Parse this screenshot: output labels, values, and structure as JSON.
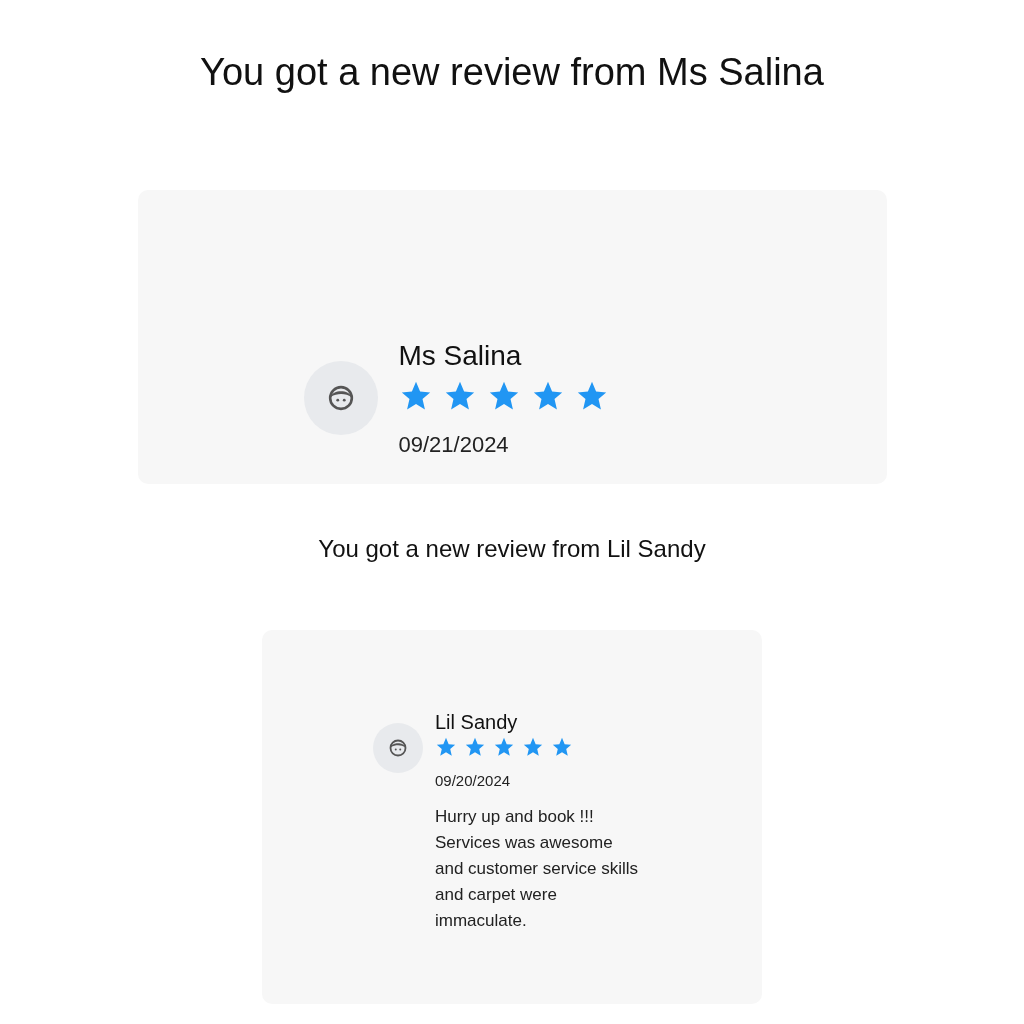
{
  "reviews": [
    {
      "heading": "You got a new review from Ms Salina",
      "name": "Ms Salina",
      "stars": 5,
      "date": "09/21/2024"
    },
    {
      "heading": "You got a new review from Lil Sandy",
      "name": "Lil Sandy",
      "stars": 5,
      "date": "09/20/2024",
      "text": "Hurry up and book !!! Services was awesome and customer service skills and carpet were immaculate."
    }
  ]
}
